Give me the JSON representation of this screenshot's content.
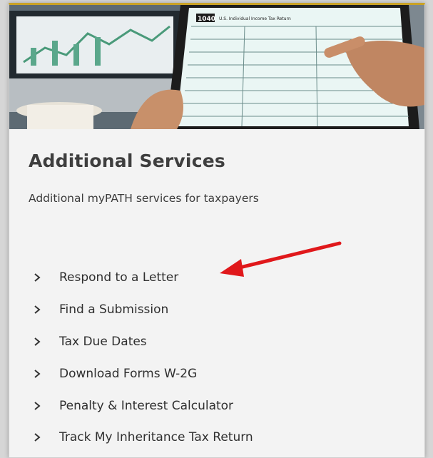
{
  "card": {
    "title": "Additional Services",
    "subtitle": "Additional myPATH services for taxpayers"
  },
  "hero": {
    "form_number": "1040",
    "form_caption": "U.S. Individual Income Tax Return"
  },
  "links": [
    {
      "label": "Respond to a Letter",
      "icon": "chevron-right-icon"
    },
    {
      "label": "Find a Submission",
      "icon": "chevron-right-icon"
    },
    {
      "label": "Tax Due Dates",
      "icon": "chevron-right-icon"
    },
    {
      "label": "Download Forms W-2G",
      "icon": "chevron-right-icon"
    },
    {
      "label": "Penalty & Interest Calculator",
      "icon": "chevron-right-icon"
    },
    {
      "label": "Track My Inheritance Tax Return",
      "icon": "chevron-right-icon"
    }
  ],
  "annotation": {
    "arrow_color": "#e0181b",
    "points_to": "Respond to a Letter"
  },
  "colors": {
    "card_top_border": "#c9a227",
    "card_background": "#f3f3f3",
    "text": "#3e3e3e"
  }
}
